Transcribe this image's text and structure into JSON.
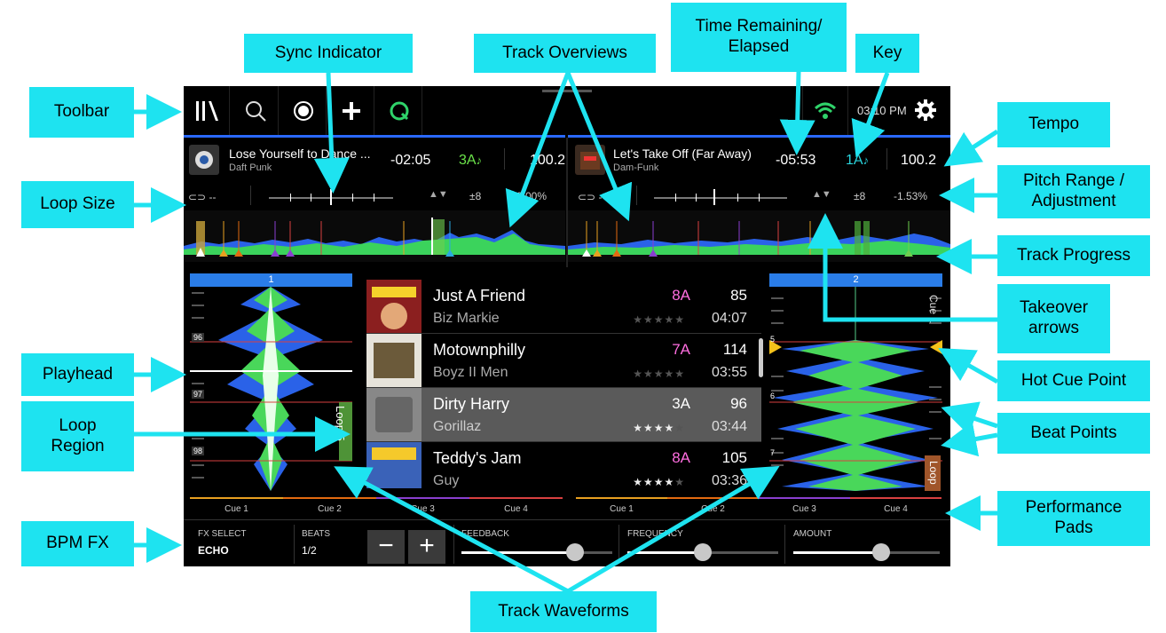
{
  "callouts": {
    "toolbar": "Toolbar",
    "sync_indicator": "Sync Indicator",
    "track_overviews": "Track Overviews",
    "time_remaining": "Time Remaining/\nElapsed",
    "key": "Key",
    "tempo": "Tempo",
    "loop_size": "Loop Size",
    "pitch_range": "Pitch Range /\nAdjustment",
    "track_progress": "Track Progress",
    "takeover_arrows": "Takeover\narrows",
    "playhead": "Playhead",
    "hot_cue_point": "Hot Cue Point",
    "loop_region": "Loop\nRegion",
    "beat_points": "Beat Points",
    "performance_pads": "Performance\nPads",
    "bpm_fx": "BPM FX",
    "track_waveforms": "Track Waveforms"
  },
  "toolbar": {
    "clock": "03:10 PM",
    "icons": [
      "library-icon",
      "search-icon",
      "record-icon",
      "split-view-icon",
      "quantize-icon",
      "wifi-icon",
      "gear-icon"
    ]
  },
  "deck1": {
    "title": "Lose Yourself to Dance ...",
    "artist": "Daft Punk",
    "time": "-02:05",
    "key": "3A",
    "bpm": "100.2",
    "loop_size": "--",
    "pitch_range": "±8",
    "pitch": "0.00%",
    "deck_number": "1",
    "beat_markers": [
      "96",
      "97",
      "98"
    ],
    "loop_label": "Loop 5"
  },
  "deck2": {
    "title": "Let's Take Off (Far Away)",
    "artist": "Dam-Funk",
    "time": "-05:53",
    "key": "1A",
    "bpm": "100.2",
    "loop_size": "--",
    "pitch_range": "±8",
    "pitch": "-1.53%",
    "deck_number": "2",
    "beat_markers": [
      "5",
      "6",
      "7"
    ],
    "cue_label": "Cue 1",
    "loop_label": "Loop"
  },
  "tracks": [
    {
      "title": "Just A Friend",
      "artist": "Biz Markie",
      "key": "8A",
      "bpm": "85",
      "time": "04:07",
      "rating": 0,
      "key_color": "#ff6ee0"
    },
    {
      "title": "Motownphilly",
      "artist": "Boyz II Men",
      "key": "7A",
      "bpm": "114",
      "time": "03:55",
      "rating": 0,
      "key_color": "#ff6ee0"
    },
    {
      "title": "Dirty Harry",
      "artist": "Gorillaz",
      "key": "3A",
      "bpm": "96",
      "time": "03:44",
      "rating": 4,
      "key_color": "#ffffff"
    },
    {
      "title": "Teddy's Jam",
      "artist": "Guy",
      "key": "8A",
      "bpm": "105",
      "time": "03:36",
      "rating": 4,
      "key_color": "#ff6ee0"
    }
  ],
  "pads": {
    "left": [
      "Cue 1",
      "Cue 2",
      "Cue 3",
      "Cue 4"
    ],
    "right": [
      "Cue 1",
      "Cue 2",
      "Cue 3",
      "Cue 4"
    ],
    "colors": [
      "#e8a020",
      "#e36a10",
      "#8a3fd0",
      "#d84040"
    ]
  },
  "fx": {
    "select_label": "FX SELECT",
    "select_value": "ECHO",
    "beats_label": "BEATS",
    "beats_value": "1/2",
    "minus": "−",
    "plus": "+",
    "feedback_label": "FEEDBACK",
    "feedback_value": 0.75,
    "frequency_label": "FREQUENCY",
    "frequency_value": 0.5,
    "amount_label": "AMOUNT",
    "amount_value": 0.6
  }
}
